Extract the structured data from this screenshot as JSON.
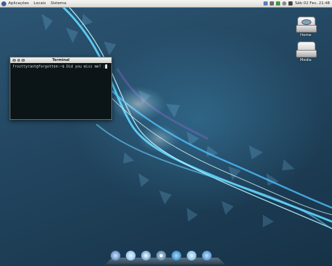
{
  "top_panel": {
    "menus": [
      "Aplicações",
      "Locais",
      "Sistema"
    ],
    "clock": "Sáb 02 Fev, 21:48"
  },
  "desktop_icons": [
    {
      "label": "Home"
    },
    {
      "label": "Media"
    }
  ],
  "terminal": {
    "title": "Terminal",
    "prompt_line": "frosttyrant@forgotten:~$ Did you miss me? :"
  },
  "dock": {
    "icons": [
      "finder-icon",
      "chat-icon",
      "network-icon",
      "disc-icon",
      "bird-icon",
      "feather-icon",
      "globe-icon"
    ]
  },
  "colors": {
    "wallpaper_accent": "#4fd0ff",
    "panel_bg": "#e9e9e6",
    "terminal_bg": "#0b1416"
  }
}
